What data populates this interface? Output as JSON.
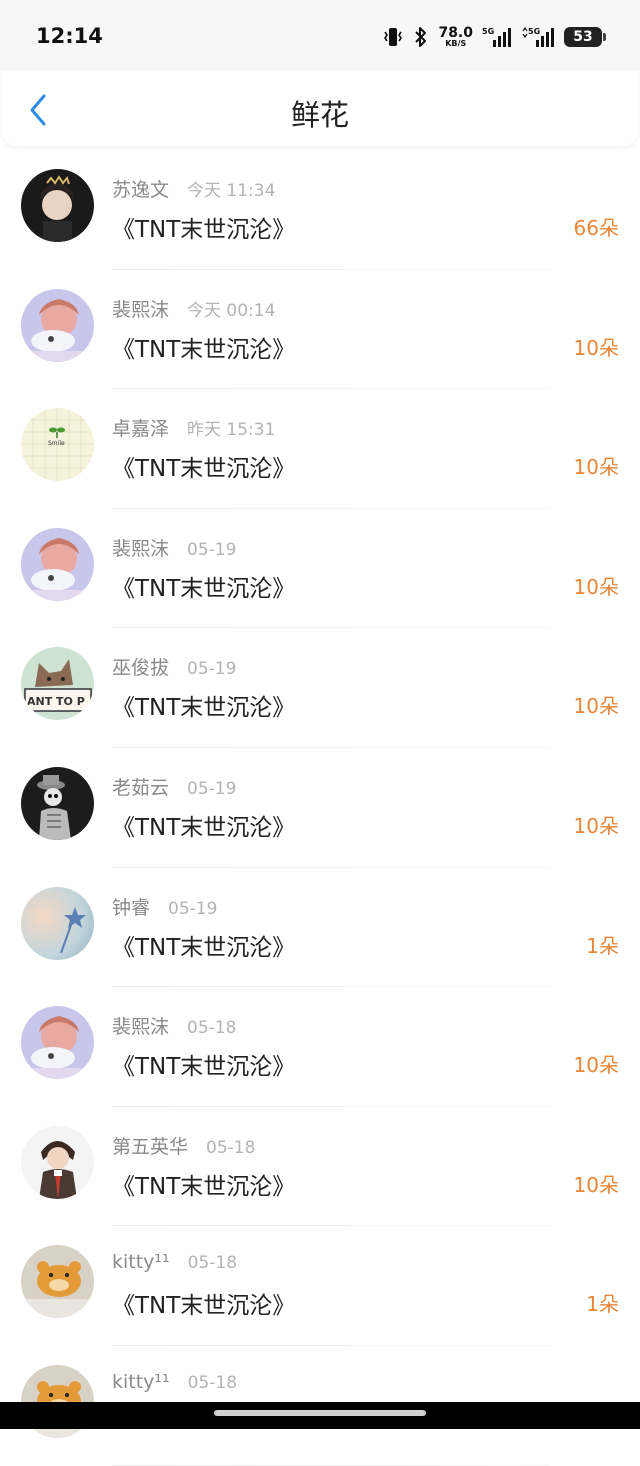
{
  "status_bar": {
    "time": "12:14",
    "network_speed": "78.0",
    "network_speed_unit": "KB/S",
    "signal_1_label": "5G",
    "signal_2_label": "5G",
    "battery": "53",
    "icons": [
      "vibrate-icon",
      "bluetooth-icon",
      "signal-icon",
      "signal-icon",
      "battery-icon"
    ]
  },
  "header": {
    "title": "鲜花",
    "back_icon": "chevron-left-icon"
  },
  "colors": {
    "accent_blue": "#2e8de6",
    "count_orange": "#e8863a"
  },
  "flowers": [
    {
      "name": "苏逸文",
      "time": "今天 11:34",
      "book": "《TNT末世沉沦》",
      "count": "66朵",
      "avatar": "avatar-dark-crown"
    },
    {
      "name": "裴熙沫",
      "time": "今天 00:14",
      "book": "《TNT末世沉沦》",
      "count": "10朵",
      "avatar": "avatar-pink-girl"
    },
    {
      "name": "卓嘉泽",
      "time": "昨天 15:31",
      "book": "《TNT末世沉沦》",
      "count": "10朵",
      "avatar": "avatar-sprout-smile"
    },
    {
      "name": "裴熙沫",
      "time": "05-19",
      "book": "《TNT末世沉沦》",
      "count": "10朵",
      "avatar": "avatar-pink-girl"
    },
    {
      "name": "巫俊拔",
      "time": "05-19",
      "book": "《TNT末世沉沦》",
      "count": "10朵",
      "avatar": "avatar-cat-sign"
    },
    {
      "name": "老茹云",
      "time": "05-19",
      "book": "《TNT末世沉沦》",
      "count": "10朵",
      "avatar": "avatar-skeleton"
    },
    {
      "name": "钟睿",
      "time": "05-19",
      "book": "《TNT末世沉沦》",
      "count": "1朵",
      "avatar": "avatar-star-wand"
    },
    {
      "name": "裴熙沫",
      "time": "05-18",
      "book": "《TNT末世沉沦》",
      "count": "10朵",
      "avatar": "avatar-pink-girl"
    },
    {
      "name": "第五英华",
      "time": "05-18",
      "book": "《TNT末世沉沦》",
      "count": "10朵",
      "avatar": "avatar-anime-boy"
    },
    {
      "name": "kitty¹¹",
      "time": "05-18",
      "book": "《TNT末世沉沦》",
      "count": "1朵",
      "avatar": "avatar-orange-bear"
    },
    {
      "name": "kitty¹¹",
      "time": "05-18",
      "book": "",
      "count": "",
      "avatar": "avatar-orange-bear"
    }
  ]
}
